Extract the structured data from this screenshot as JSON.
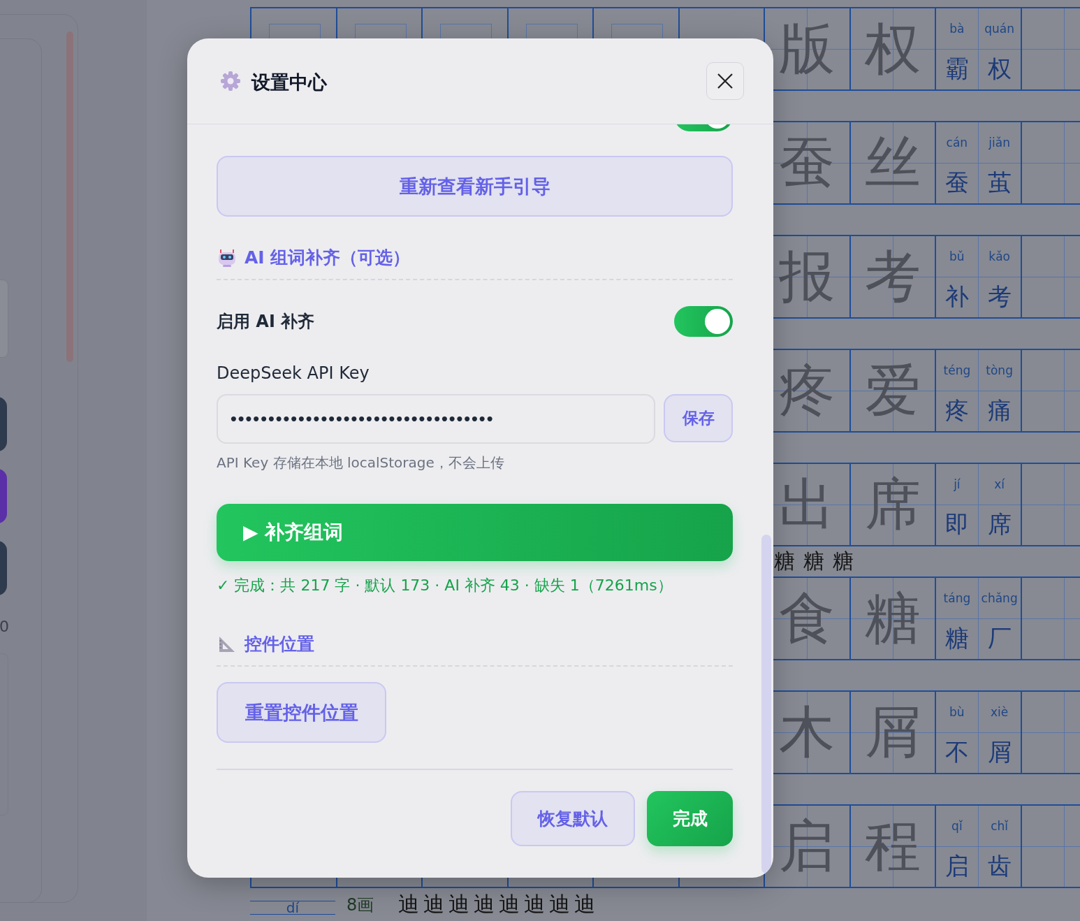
{
  "side_panel": {
    "buttons": [
      {
        "color": "#2e3a4d"
      },
      {
        "color": "#5b2fa8"
      },
      {
        "color": "#2e3a4d"
      }
    ],
    "counter": "0"
  },
  "worksheet": {
    "rows": [
      {
        "practice": [
          "版",
          "权"
        ],
        "pair": {
          "pinyin": [
            "bà",
            "quán"
          ],
          "chars": [
            "霸",
            "权"
          ]
        }
      },
      {
        "practice": [
          "蚕",
          "丝"
        ],
        "pair": {
          "pinyin": [
            "cán",
            "jiǎn"
          ],
          "chars": [
            "蚕",
            "茧"
          ]
        }
      },
      {
        "practice": [
          "报",
          "考"
        ],
        "pair": {
          "pinyin": [
            "bǔ",
            "kǎo"
          ],
          "chars": [
            "补",
            "考"
          ]
        }
      },
      {
        "practice": [
          "疼",
          "爱"
        ],
        "pair": {
          "pinyin": [
            "téng",
            "tòng"
          ],
          "chars": [
            "疼",
            "痛"
          ]
        }
      },
      {
        "practice": [
          "出",
          "席"
        ],
        "pair": {
          "pinyin": [
            "jí",
            "xí"
          ],
          "chars": [
            "即",
            "席"
          ]
        },
        "strip_after": {
          "strokes": [
            "糖",
            "糖",
            "糖"
          ]
        }
      },
      {
        "practice": [
          "食",
          "糖"
        ],
        "pair": {
          "pinyin": [
            "táng",
            "chǎng"
          ],
          "chars": [
            "糖",
            "厂"
          ]
        }
      },
      {
        "practice": [
          "木",
          "屑"
        ],
        "pair": {
          "pinyin": [
            "bù",
            "xiè"
          ],
          "chars": [
            "不",
            "屑"
          ]
        }
      },
      {
        "practice": [
          "启",
          "程"
        ],
        "pair": {
          "pinyin": [
            "qǐ",
            "chǐ"
          ],
          "chars": [
            "启",
            "齿"
          ]
        }
      }
    ],
    "bottom_strip": {
      "pinyin": "dí",
      "stroke_count": "8画",
      "strokes": [
        "迪",
        "迪",
        "迪",
        "迪",
        "迪",
        "迪",
        "迪",
        "迪"
      ]
    }
  },
  "dialog": {
    "title": "设置中心",
    "hidden_toggle": {
      "on": true
    },
    "guide_button": "重新查看新手引导",
    "ai_section": {
      "heading": "AI 组词补齐（可选）",
      "enable": {
        "label": "启用 AI 补齐",
        "on": true
      },
      "api_key": {
        "label": "DeepSeek API Key",
        "value": "•••••••••••••••••••••••••••••••••••",
        "save": "保存",
        "hint": "API Key 存储在本地 localStorage，不会上传"
      },
      "run_button": "▶ 补齐组词",
      "status": "✓ 完成：共 217 字 · 默认 173 · AI 补齐 43 · 缺失 1（7261ms）"
    },
    "layout_section": {
      "heading": "控件位置",
      "reset_button": "重置控件位置"
    },
    "footer": {
      "buttons": [
        {
          "label": "恢复默认",
          "kind": "secondary"
        },
        {
          "label": "完成",
          "kind": "primary"
        }
      ]
    }
  }
}
